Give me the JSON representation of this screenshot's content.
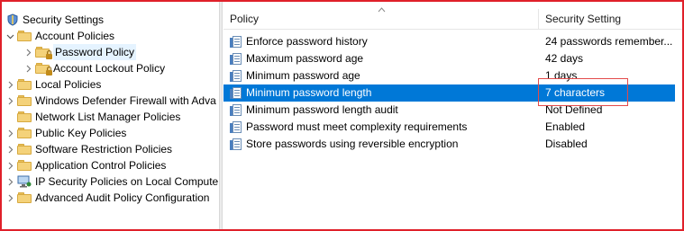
{
  "tree": {
    "items": [
      {
        "label": "Security Settings",
        "icon": "shield-icon",
        "arrow": "expanded"
      },
      {
        "label": "Account Policies",
        "icon": "folder-icon",
        "arrow": "expanded"
      },
      {
        "label": "Password Policy",
        "icon": "lock-folder-icon",
        "arrow": "collapsed"
      },
      {
        "label": "Account Lockout Policy",
        "icon": "lock-folder-icon",
        "arrow": "collapsed"
      },
      {
        "label": "Local Policies",
        "icon": "folder-icon",
        "arrow": "collapsed"
      },
      {
        "label": "Windows Defender Firewall with Adva",
        "icon": "folder-icon",
        "arrow": "collapsed"
      },
      {
        "label": "Network List Manager Policies",
        "icon": "folder-icon",
        "arrow": "none"
      },
      {
        "label": "Public Key Policies",
        "icon": "folder-icon",
        "arrow": "collapsed"
      },
      {
        "label": "Software Restriction Policies",
        "icon": "folder-icon",
        "arrow": "collapsed"
      },
      {
        "label": "Application Control Policies",
        "icon": "folder-icon",
        "arrow": "collapsed"
      },
      {
        "label": "IP Security Policies on Local Compute",
        "icon": "computer-icon",
        "arrow": "collapsed"
      },
      {
        "label": "Advanced Audit Policy Configuration",
        "icon": "folder-icon",
        "arrow": "collapsed"
      }
    ],
    "selected_item": "Password Policy"
  },
  "list": {
    "columns": {
      "policy": "Policy",
      "setting": "Security Setting"
    },
    "rows": [
      {
        "policy": "Enforce password history",
        "setting": "24 passwords remember..."
      },
      {
        "policy": "Maximum password age",
        "setting": "42 days"
      },
      {
        "policy": "Minimum password age",
        "setting": "1 days"
      },
      {
        "policy": "Minimum password length",
        "setting": "7 characters"
      },
      {
        "policy": "Minimum password length audit",
        "setting": "Not Defined"
      },
      {
        "policy": "Password must meet complexity requirements",
        "setting": "Enabled"
      },
      {
        "policy": "Store passwords using reversible encryption",
        "setting": "Disabled"
      }
    ],
    "selected_row": "Minimum password length"
  },
  "colors": {
    "selection": "#0078d7",
    "annotation": "#e34a4a",
    "frame": "#e0202a"
  }
}
